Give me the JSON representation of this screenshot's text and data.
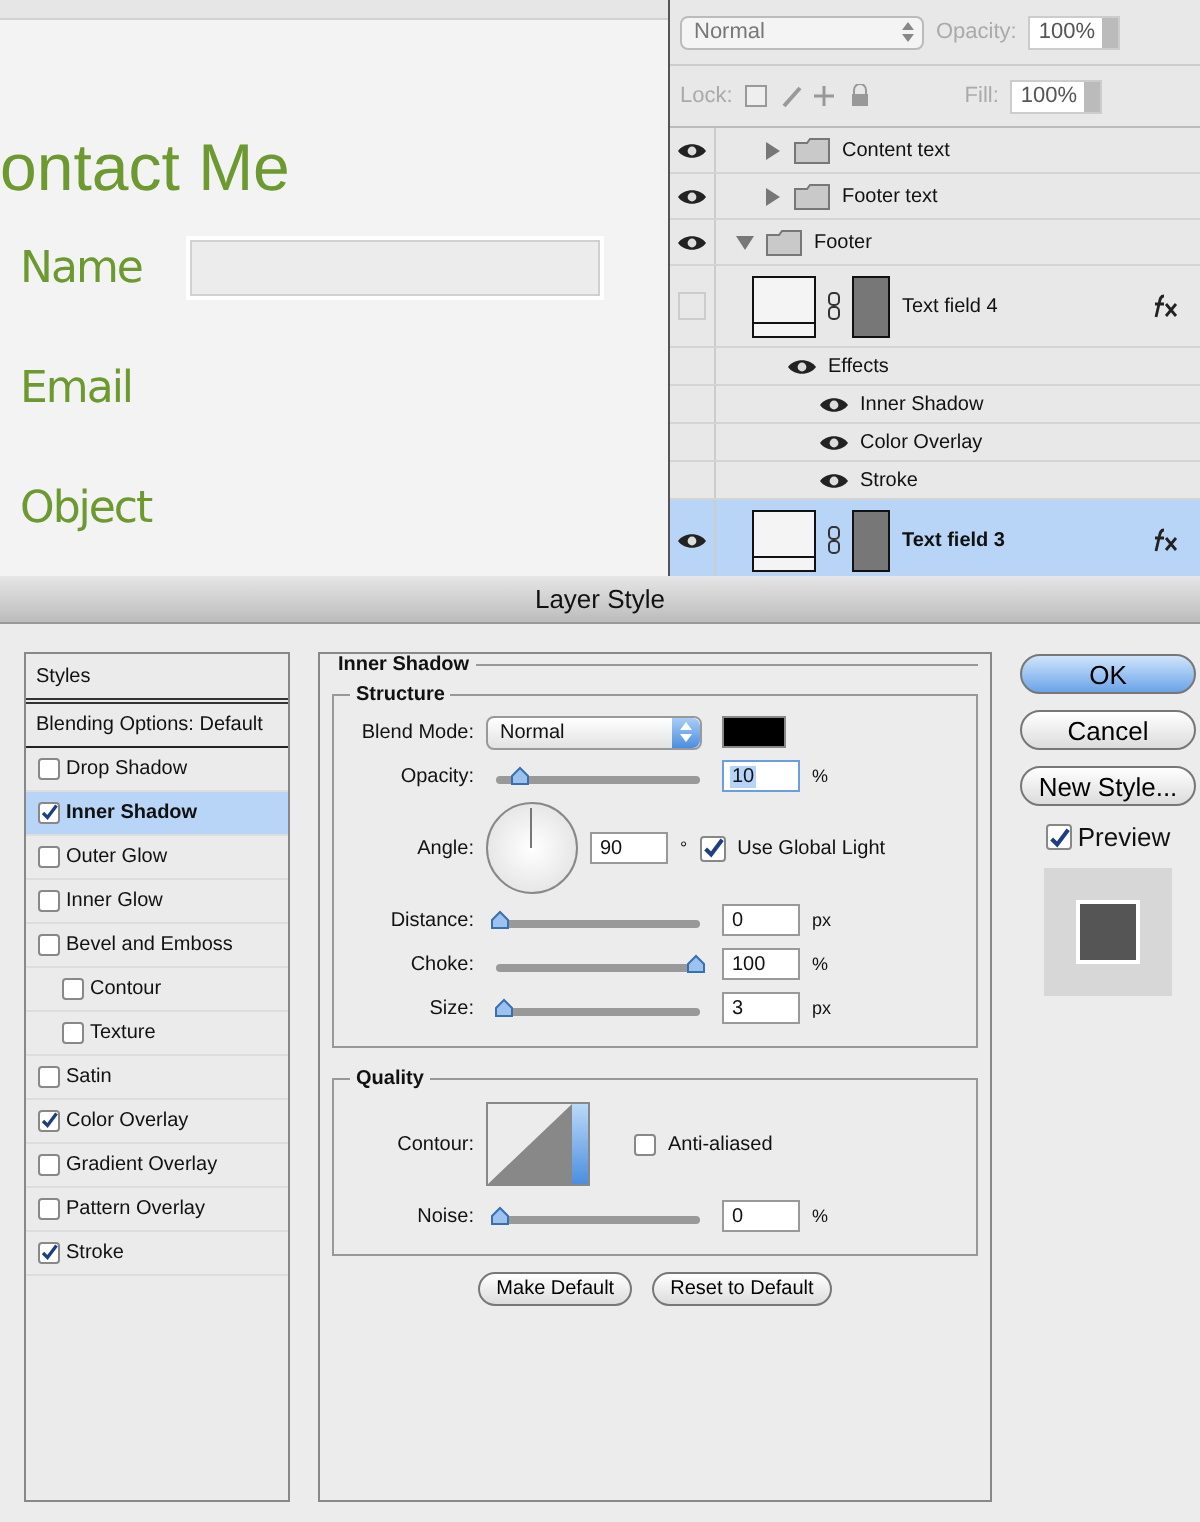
{
  "canvas": {
    "heading": "ontact Me",
    "form_rows": [
      {
        "label": "Name",
        "kind": "input"
      },
      {
        "label": "Email",
        "kind": "label"
      },
      {
        "label": "Object",
        "kind": "label"
      }
    ]
  },
  "layers_panel": {
    "blend_mode": "Normal",
    "opacity_label": "Opacity:",
    "opacity": "100%",
    "lock_label": "Lock:",
    "fill_label": "Fill:",
    "fill": "100%",
    "layers": [
      {
        "name": "Content text",
        "kind": "group",
        "visible": true,
        "expanded": false,
        "selected": false
      },
      {
        "name": "Footer text",
        "kind": "group",
        "visible": true,
        "expanded": false,
        "selected": false
      },
      {
        "name": "Footer",
        "kind": "group",
        "visible": true,
        "expanded": true,
        "selected": false,
        "children": [
          {
            "name": "Text field 4",
            "kind": "layer",
            "visible": false,
            "selected": false,
            "fx": true,
            "children": [
              {
                "name": "Effects",
                "kind": "effects",
                "visible": true,
                "children": [
                  {
                    "name": "Inner Shadow",
                    "kind": "effect",
                    "visible": true
                  },
                  {
                    "name": "Color Overlay",
                    "kind": "effect",
                    "visible": true
                  },
                  {
                    "name": "Stroke",
                    "kind": "effect",
                    "visible": true
                  }
                ]
              }
            ]
          },
          {
            "name": "Text field 3",
            "kind": "layer",
            "visible": true,
            "selected": true,
            "fx": true
          }
        ]
      }
    ]
  },
  "dialog": {
    "title": "Layer Style",
    "styles_header": "Styles",
    "blending_options": "Blending Options: Default",
    "styles": [
      {
        "label": "Drop Shadow",
        "checked": false,
        "selected": false
      },
      {
        "label": "Inner Shadow",
        "checked": true,
        "selected": true
      },
      {
        "label": "Outer Glow",
        "checked": false,
        "selected": false
      },
      {
        "label": "Inner Glow",
        "checked": false,
        "selected": false
      },
      {
        "label": "Bevel and Emboss",
        "checked": false,
        "selected": false,
        "children": [
          {
            "label": "Contour",
            "checked": false,
            "selected": false
          },
          {
            "label": "Texture",
            "checked": false,
            "selected": false
          }
        ]
      },
      {
        "label": "Satin",
        "checked": false,
        "selected": false
      },
      {
        "label": "Color Overlay",
        "checked": true,
        "selected": false
      },
      {
        "label": "Gradient Overlay",
        "checked": false,
        "selected": false
      },
      {
        "label": "Pattern Overlay",
        "checked": false,
        "selected": false
      },
      {
        "label": "Stroke",
        "checked": true,
        "selected": false
      }
    ],
    "section_title": "Inner Shadow",
    "structure": {
      "title": "Structure",
      "rows": [
        {
          "kind": "select",
          "label": "Blend Mode:",
          "value": "Normal",
          "color": "#000000"
        },
        {
          "kind": "slider",
          "label": "Opacity:",
          "level": 0.1,
          "value": "10",
          "unit": "%",
          "focused": true
        },
        {
          "kind": "angle",
          "label": "Angle:",
          "value": "90",
          "unit": "°",
          "checkbox_label": "Use Global Light",
          "checked": true
        },
        {
          "kind": "slider",
          "label": "Distance:",
          "level": 0,
          "value": "0",
          "unit": "px",
          "focused": false
        },
        {
          "kind": "slider",
          "label": "Choke:",
          "level": 1,
          "value": "100",
          "unit": "%",
          "focused": false
        },
        {
          "kind": "slider",
          "label": "Size:",
          "level": 0.02,
          "value": "3",
          "unit": "px",
          "focused": false
        }
      ]
    },
    "quality": {
      "title": "Quality",
      "rows": [
        {
          "kind": "contour",
          "label": "Contour:",
          "checkbox_label": "Anti-aliased",
          "checked": false
        },
        {
          "kind": "slider",
          "label": "Noise:",
          "level": 0,
          "value": "0",
          "unit": "%",
          "focused": false
        }
      ]
    },
    "bottom_buttons": [
      "Make Default",
      "Reset to Default"
    ],
    "buttons": [
      {
        "label": "OK",
        "default": true
      },
      {
        "label": "Cancel",
        "default": false
      },
      {
        "label": "New Style...",
        "default": false
      }
    ],
    "preview": {
      "label": "Preview",
      "checked": true
    }
  }
}
